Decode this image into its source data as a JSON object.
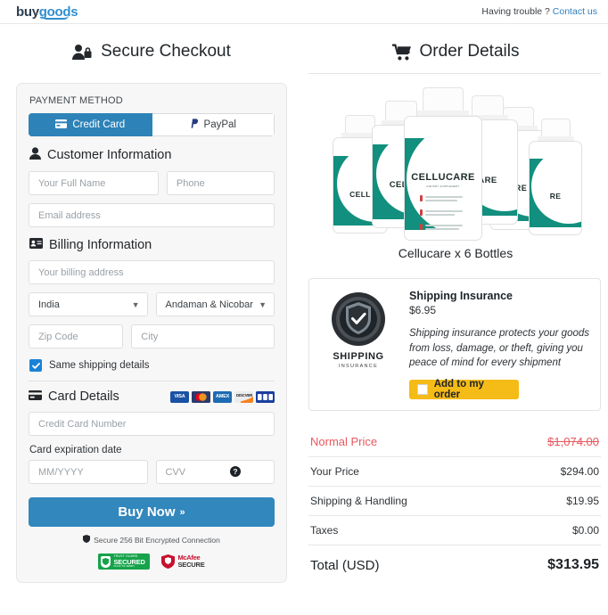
{
  "header": {
    "logo_primary": "buy",
    "logo_secondary": "goods",
    "help_text": "Having trouble ?",
    "help_link": "Contact us"
  },
  "left": {
    "title": "Secure Checkout",
    "title_icon": "user-lock-icon",
    "payment_method_label": "PAYMENT METHOD",
    "tabs": [
      {
        "label": "Credit Card",
        "icon": "credit-card-icon",
        "active": true
      },
      {
        "label": "PayPal",
        "icon": "paypal-icon",
        "active": false
      }
    ],
    "customer": {
      "heading": "Customer Information",
      "icon": "user-icon",
      "full_name_placeholder": "Your Full Name",
      "phone_placeholder": "Phone",
      "email_placeholder": "Email address"
    },
    "billing": {
      "heading": "Billing Information",
      "icon": "id-card-icon",
      "address_placeholder": "Your billing address",
      "country_value": "India",
      "state_value": "Andaman & Nicobar",
      "zip_placeholder": "Zip Code",
      "city_placeholder": "City"
    },
    "same_shipping_label": "Same shipping details",
    "card_details": {
      "heading": "Card Details",
      "icon": "credit-card-icon",
      "accepted": [
        "VISA",
        "Mastercard",
        "AMEX",
        "Discover",
        "JCB"
      ],
      "number_placeholder": "Credit Card Number",
      "expiration_label": "Card expiration date",
      "expiration_placeholder": "MM/YYYY",
      "cvv_placeholder": "CVV",
      "cvv_help_icon": "question-mark-icon"
    },
    "buy_button": "Buy Now",
    "buy_button_arrow": "»",
    "secure_note": "Secure 256 Bit Encrypted Connection",
    "trust_badge": {
      "top": "TRUST GUARD",
      "main": "SECURED",
      "bottom": "CLICK TO VERIFY"
    },
    "mcafee_badge": {
      "line1": "McAfee",
      "line2": "SECURE"
    }
  },
  "right": {
    "title": "Order Details",
    "title_icon": "shopping-cart-icon",
    "product": {
      "name": "Cellucare x 6 Bottles",
      "bottle_label": "CELLUCARE",
      "bottle_sub": "DIETARY SUPPLEMENT",
      "bottle_count": 6
    },
    "insurance": {
      "seal_title": "SHIPPING",
      "seal_sub": "INSURANCE",
      "heading": "Shipping Insurance",
      "price": "$6.95",
      "description": "Shipping insurance protects your goods from loss, damage, or theft, giving you peace of mind for every shipment",
      "button_label": "Add to my order",
      "button_checked": false
    },
    "totals": [
      {
        "label": "Normal Price",
        "value": "$1,074.00",
        "style": "normal"
      },
      {
        "label": "Your Price",
        "value": "$294.00",
        "style": "plain"
      },
      {
        "label": "Shipping & Handling",
        "value": "$19.95",
        "style": "plain"
      },
      {
        "label": "Taxes",
        "value": "$0.00",
        "style": "plain"
      },
      {
        "label": "Total (USD)",
        "value": "$313.95",
        "style": "total"
      }
    ]
  },
  "colors": {
    "accent_blue": "#3287bd",
    "tab_active": "#2d83b8",
    "yellow": "#f5bb17",
    "strike_red": "#e8585f",
    "bottle_teal": "#128f7e"
  }
}
